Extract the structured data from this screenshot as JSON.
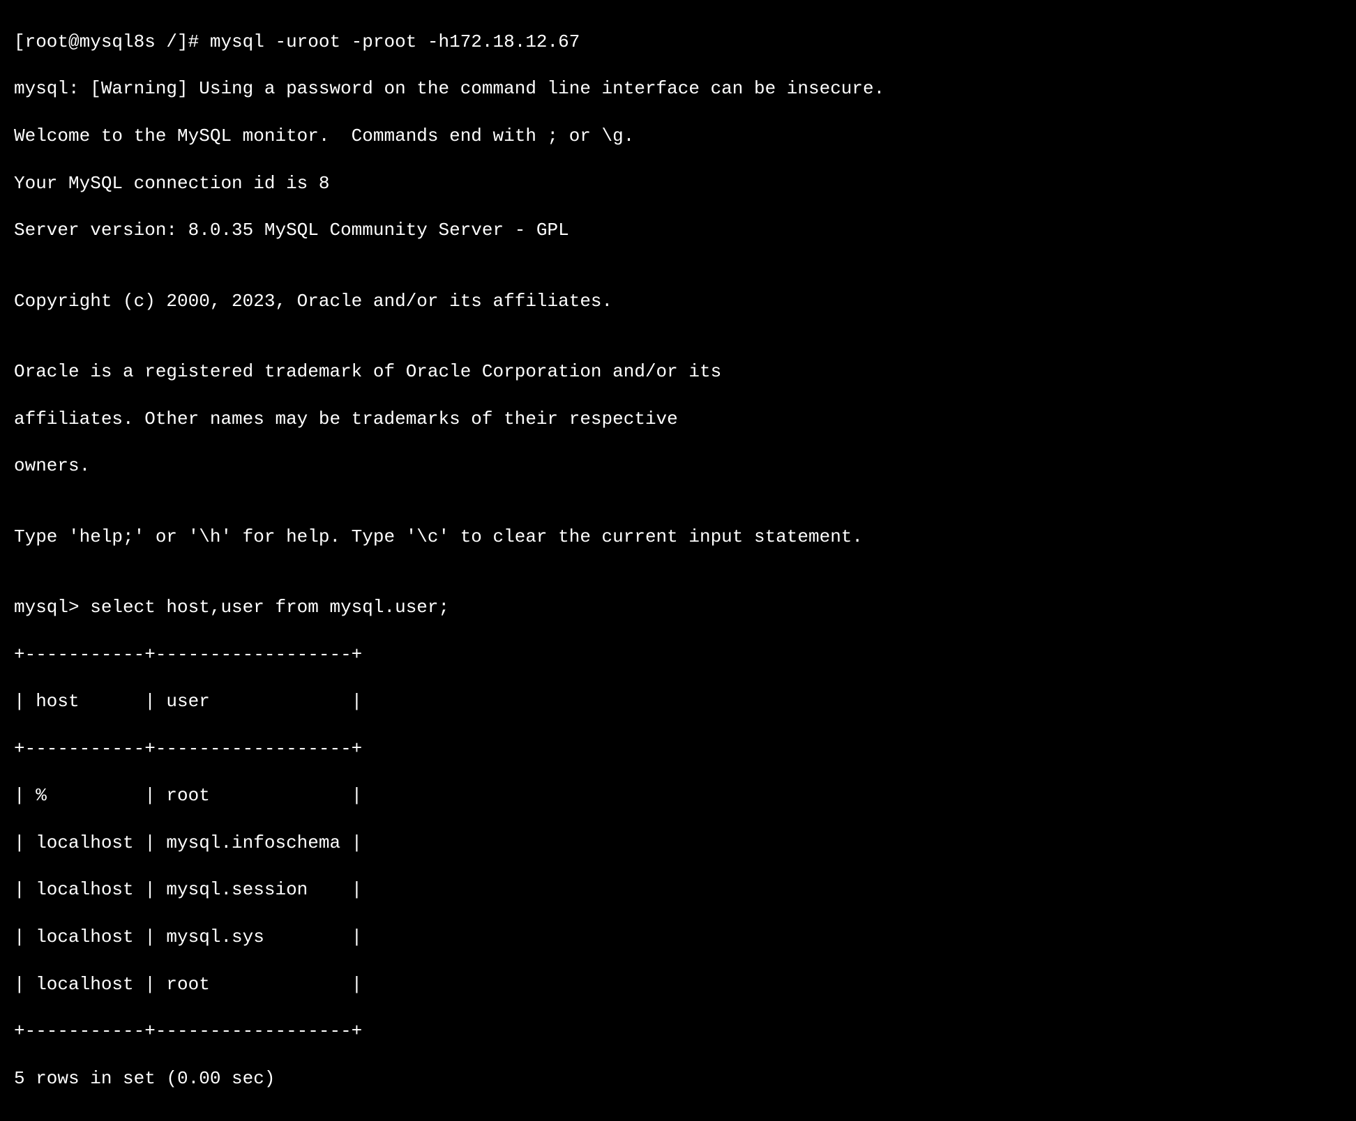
{
  "terminal": {
    "prompt_line": "[root@mysql8s /]# mysql -uroot -proot -h172.18.12.67",
    "warning": "mysql: [Warning] Using a password on the command line interface can be insecure.",
    "welcome": "Welcome to the MySQL monitor.  Commands end with ; or \\g.",
    "connection_id": "Your MySQL connection id is 8",
    "server_version": "Server version: 8.0.35 MySQL Community Server - GPL",
    "blank1": "",
    "copyright": "Copyright (c) 2000, 2023, Oracle and/or its affiliates.",
    "blank2": "",
    "trademark1": "Oracle is a registered trademark of Oracle Corporation and/or its",
    "trademark2": "affiliates. Other names may be trademarks of their respective",
    "trademark3": "owners.",
    "blank3": "",
    "help_line": "Type 'help;' or '\\h' for help. Type '\\c' to clear the current input statement.",
    "blank4": "",
    "query_line": "mysql> select host,user from mysql.user;",
    "table_border_top": "+-----------+------------------+",
    "table_header": "| host      | user             |",
    "table_border_mid": "+-----------+------------------+",
    "table_row1": "| %         | root             |",
    "table_row2": "| localhost | mysql.infoschema |",
    "table_row3": "| localhost | mysql.session    |",
    "table_row4": "| localhost | mysql.sys        |",
    "table_row5": "| localhost | root             |",
    "table_border_bot": "+-----------+------------------+",
    "result_summary": "5 rows in set (0.00 sec)"
  }
}
